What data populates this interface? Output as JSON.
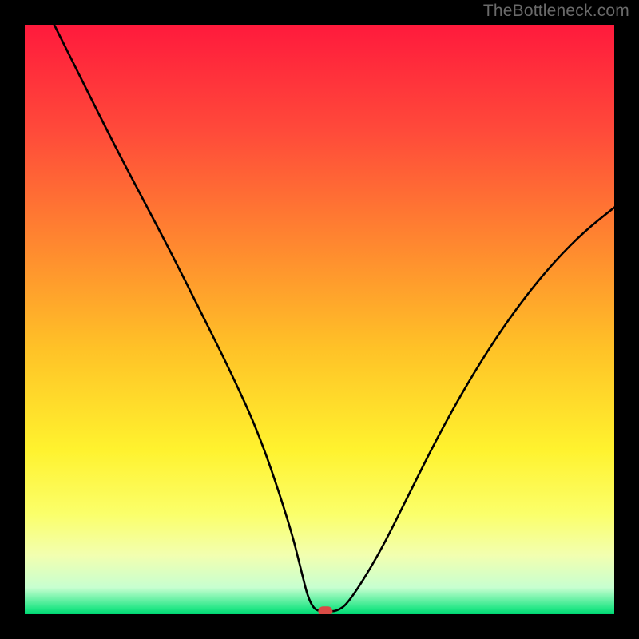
{
  "watermark": "TheBottleneck.com",
  "chart_data": {
    "type": "line",
    "title": "",
    "xlabel": "",
    "ylabel": "",
    "xlim": [
      0,
      100
    ],
    "ylim": [
      0,
      100
    ],
    "grid": false,
    "legend": false,
    "annotations": [],
    "series": [
      {
        "name": "curve",
        "x": [
          5,
          10,
          15,
          20,
          25,
          30,
          35,
          40,
          45,
          47,
          48,
          49,
          50,
          51,
          53,
          55,
          60,
          65,
          70,
          75,
          80,
          85,
          90,
          95,
          100
        ],
        "y": [
          100,
          90,
          80,
          70.5,
          61,
          51,
          41,
          30,
          15,
          7,
          3,
          1,
          0.5,
          0.5,
          0.5,
          2,
          10,
          20,
          30,
          39,
          47,
          54,
          60,
          65,
          69
        ]
      }
    ],
    "marker": {
      "x": 51,
      "y": 0.5,
      "color": "#d94b45"
    },
    "background_gradient": {
      "stops": [
        {
          "pos": 0.0,
          "color": "#ff1a3c"
        },
        {
          "pos": 0.18,
          "color": "#ff4a3a"
        },
        {
          "pos": 0.38,
          "color": "#ff8a2f"
        },
        {
          "pos": 0.55,
          "color": "#ffc227"
        },
        {
          "pos": 0.72,
          "color": "#fff22e"
        },
        {
          "pos": 0.83,
          "color": "#fbff6a"
        },
        {
          "pos": 0.9,
          "color": "#f2ffb0"
        },
        {
          "pos": 0.955,
          "color": "#c7ffd0"
        },
        {
          "pos": 0.99,
          "color": "#25e787"
        },
        {
          "pos": 1.0,
          "color": "#00d673"
        }
      ]
    }
  }
}
